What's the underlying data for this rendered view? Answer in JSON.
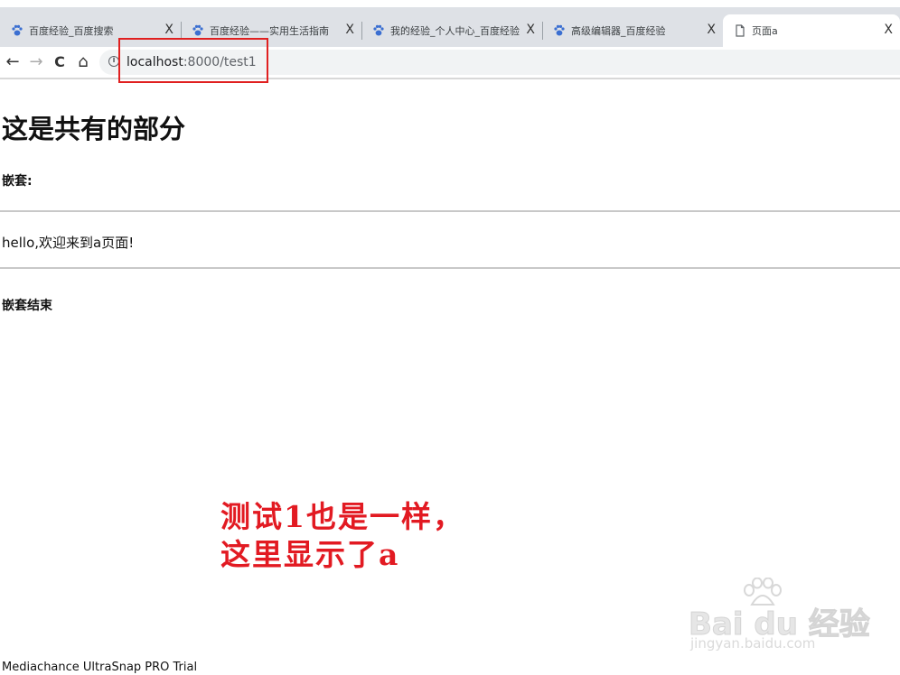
{
  "browser": {
    "tabs": [
      {
        "title": "百度经验_百度搜索",
        "icon": "baidu-paw-icon",
        "close": "X"
      },
      {
        "title": "百度经验——实用生活指南",
        "icon": "baidu-paw-icon",
        "close": "X"
      },
      {
        "title": "我的经验_个人中心_百度经验",
        "icon": "baidu-paw-icon",
        "close": "X"
      },
      {
        "title": "高级编辑器_百度经验",
        "icon": "baidu-paw-icon",
        "close": "X"
      },
      {
        "title": "页面a",
        "icon": "page-icon",
        "close": "X",
        "active": true
      }
    ],
    "nav": {
      "back": "←",
      "forward": "→",
      "reload": "C",
      "home": "⌂"
    },
    "address": {
      "host": "localhost",
      "rest": ":8000/test1",
      "info_icon": "i"
    }
  },
  "page": {
    "heading": "这是共有的部分",
    "nested_label": "嵌套:",
    "message": "hello,欢迎来到a页面!",
    "nested_end": "嵌套结束"
  },
  "annotation": {
    "line1": "测试1也是一样，",
    "line2": "这里显示了a",
    "color": "#e21a22"
  },
  "watermark": {
    "logo_text": "Bai du 经验",
    "url": "jingyan.baidu.com"
  },
  "footer": {
    "trial_text": "Mediachance UltraSnap PRO Trial"
  },
  "colors": {
    "tabstrip": "#dee1e6",
    "baidu_blue": "#3b6fd1",
    "highlight_box": "#e02020"
  }
}
